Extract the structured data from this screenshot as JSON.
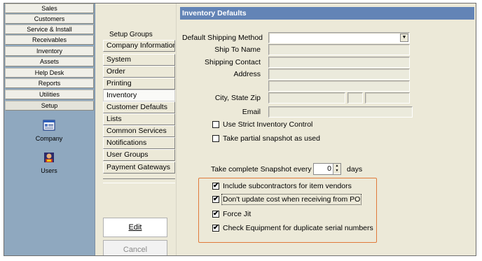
{
  "nav": {
    "buttons": [
      "Sales",
      "Customers",
      "Service & Install",
      "Receivables",
      "Inventory",
      "Assets",
      "Help Desk",
      "Reports",
      "Utilities",
      "Setup"
    ],
    "icons": [
      {
        "label": "Company",
        "icon": "company-card-icon"
      },
      {
        "label": "Users",
        "icon": "users-icon"
      }
    ]
  },
  "groups": {
    "title": "Setup Groups",
    "items": [
      "Company Information",
      "System",
      "Order",
      "Printing",
      "Inventory",
      "Customer Defaults",
      "Lists",
      "Common Services",
      "Notifications",
      "User Groups",
      "Payment Gateways"
    ],
    "selected": "Inventory",
    "edit_label": "Edit",
    "cancel_label": "Cancel"
  },
  "panel": {
    "title": "Inventory Defaults",
    "fields": {
      "default_shipping_method": "Default Shipping Method",
      "ship_to_name": "Ship To Name",
      "shipping_contact": "Shipping Contact",
      "address": "Address",
      "city_state_zip": "City, State Zip",
      "email": "Email"
    },
    "checkboxes": {
      "strict_inventory": "Use Strict Inventory Control",
      "partial_snapshot": "Take partial snapshot as used"
    },
    "snapshot": {
      "label": "Take complete Snapshot every",
      "value": "0",
      "unit": "days"
    },
    "highlighted_checkboxes": {
      "include_subcontractors": "Include subcontractors for item vendors",
      "dont_update_cost": "Don't update cost when receiving from PO",
      "force_jit": "Force Jit",
      "check_equipment": "Check Equipment for duplicate serial numbers"
    },
    "check_mark": "✔",
    "highlight_color": "#e07a3a"
  }
}
